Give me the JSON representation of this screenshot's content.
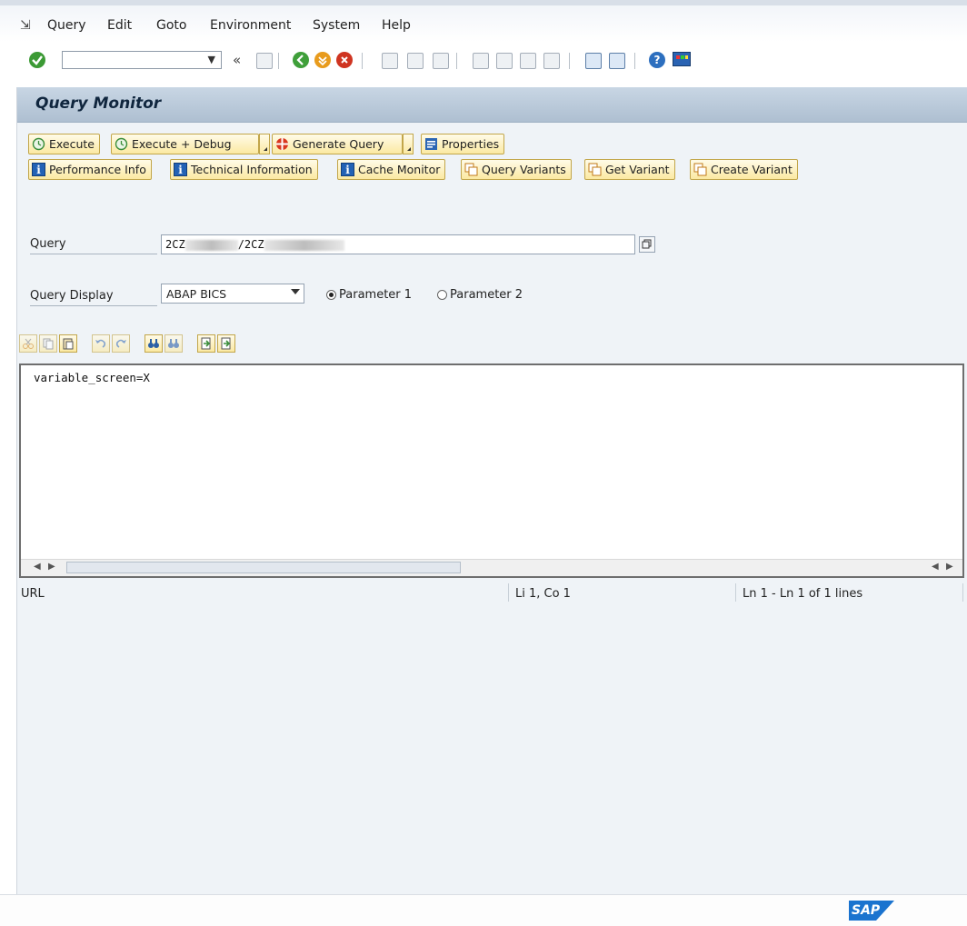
{
  "menubar": {
    "items": [
      {
        "label": "Query"
      },
      {
        "label": "Edit"
      },
      {
        "label": "Goto"
      },
      {
        "label": "Environment"
      },
      {
        "label": "System"
      },
      {
        "label": "Help"
      }
    ]
  },
  "toolbar": {
    "command_field_value": "",
    "icons": [
      "enter-icon",
      "back-icon",
      "exit-icon",
      "cancel-icon",
      "print-icon",
      "find-icon",
      "find-next-icon",
      "first-page-icon",
      "prev-page-icon",
      "next-page-icon",
      "last-page-icon",
      "create-session-icon",
      "shortcut-icon",
      "help-icon",
      "customize-layout-icon"
    ]
  },
  "title": "Query Monitor",
  "actions": {
    "execute": "Execute",
    "execute_debug": "Execute + Debug",
    "generate_query": "Generate Query",
    "properties": "Properties",
    "performance_info": "Performance Info",
    "technical_information": "Technical Information",
    "cache_monitor": "Cache Monitor",
    "query_variants": "Query Variants",
    "get_variant": "Get Variant",
    "create_variant": "Create Variant"
  },
  "form": {
    "query_label": "Query",
    "query_value_part1": "2CZ",
    "query_value_sep": "/2CZ",
    "display_label": "Query Display",
    "display_value": "ABAP BICS",
    "radio1": "Parameter 1",
    "radio2": "Parameter 2",
    "radio_selected": "Parameter 1"
  },
  "editor": {
    "content": "variable_screen=X"
  },
  "status": {
    "left": "URL",
    "position": "Li 1, Co 1",
    "lines": "Ln 1 - Ln 1 of 1 lines"
  },
  "footer": {
    "logo": "SAP"
  }
}
